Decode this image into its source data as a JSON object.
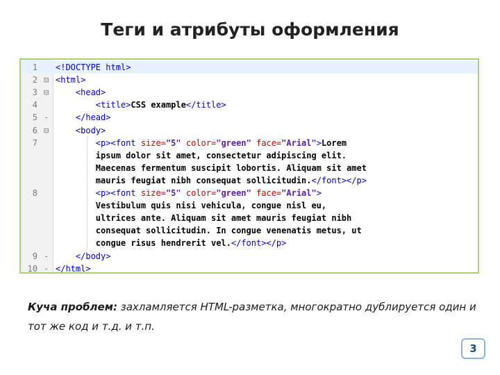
{
  "slide": {
    "title": "Теги и атрибуты оформления",
    "note_bold": "Куча проблем:",
    "note_text": " захламляется HTML-разметка, многократно дублируется один и тот же код и т.д. и т.п.",
    "page_number": "3"
  },
  "editor": {
    "lines": [
      {
        "n": "1",
        "fold": "",
        "segs": [
          [
            "tag",
            "<!DOCTYPE html>"
          ]
        ]
      },
      {
        "n": "2",
        "fold": "⊟",
        "segs": [
          [
            "tag",
            "<html>"
          ]
        ]
      },
      {
        "n": "3",
        "fold": "⊟",
        "segs": [
          [
            "txt",
            "    "
          ],
          [
            "tag",
            "<head>"
          ]
        ]
      },
      {
        "n": "4",
        "fold": "",
        "segs": [
          [
            "txt",
            "        "
          ],
          [
            "tag",
            "<title>"
          ],
          [
            "txt",
            "CSS example"
          ],
          [
            "tag",
            "</title>"
          ]
        ]
      },
      {
        "n": "5",
        "fold": "-",
        "segs": [
          [
            "txt",
            "    "
          ],
          [
            "tag",
            "</head>"
          ]
        ]
      },
      {
        "n": "6",
        "fold": "⊟",
        "segs": [
          [
            "txt",
            "    "
          ],
          [
            "tag",
            "<body>"
          ]
        ]
      },
      {
        "n": "7",
        "fold": "",
        "segs": [
          [
            "txt",
            "        "
          ],
          [
            "tag",
            "<p><font "
          ],
          [
            "attr",
            "size="
          ],
          [
            "str",
            "\"5\" "
          ],
          [
            "attr",
            "color="
          ],
          [
            "str",
            "\"green\" "
          ],
          [
            "attr",
            "face="
          ],
          [
            "str",
            "\"Arial\""
          ],
          [
            "tag",
            ">"
          ],
          [
            "txt",
            "Lorem"
          ]
        ]
      },
      {
        "n": "",
        "fold": "",
        "segs": [
          [
            "txt",
            "        ipsum dolor sit amet, consectetur adipiscing elit."
          ]
        ]
      },
      {
        "n": "",
        "fold": "",
        "segs": [
          [
            "txt",
            "        Maecenas fermentum suscipit lobortis. Aliquam sit amet"
          ]
        ]
      },
      {
        "n": "",
        "fold": "",
        "segs": [
          [
            "txt",
            "        mauris feugiat nibh consequat sollicitudin."
          ],
          [
            "tag",
            "</font></p>"
          ]
        ]
      },
      {
        "n": "8",
        "fold": "",
        "segs": [
          [
            "txt",
            "        "
          ],
          [
            "tag",
            "<p><font "
          ],
          [
            "attr",
            "size="
          ],
          [
            "str",
            "\"5\" "
          ],
          [
            "attr",
            "color="
          ],
          [
            "str",
            "\"green\" "
          ],
          [
            "attr",
            "face="
          ],
          [
            "str",
            "\"Arial\""
          ],
          [
            "tag",
            ">"
          ]
        ]
      },
      {
        "n": "",
        "fold": "",
        "segs": [
          [
            "txt",
            "        Vestibulum quis nisi vehicula, congue nisl eu,"
          ]
        ]
      },
      {
        "n": "",
        "fold": "",
        "segs": [
          [
            "txt",
            "        ultrices ante. Aliquam sit amet mauris feugiat nibh"
          ]
        ]
      },
      {
        "n": "",
        "fold": "",
        "segs": [
          [
            "txt",
            "        consequat sollicitudin. In congue venenatis metus, ut"
          ]
        ]
      },
      {
        "n": "",
        "fold": "",
        "segs": [
          [
            "txt",
            "        congue risus hendrerit vel."
          ],
          [
            "tag",
            "</font></p>"
          ]
        ]
      },
      {
        "n": "9",
        "fold": "-",
        "segs": [
          [
            "txt",
            "    "
          ],
          [
            "tag",
            "</body>"
          ]
        ]
      },
      {
        "n": "10",
        "fold": "-",
        "segs": [
          [
            "tag",
            "</html>"
          ]
        ]
      }
    ]
  }
}
